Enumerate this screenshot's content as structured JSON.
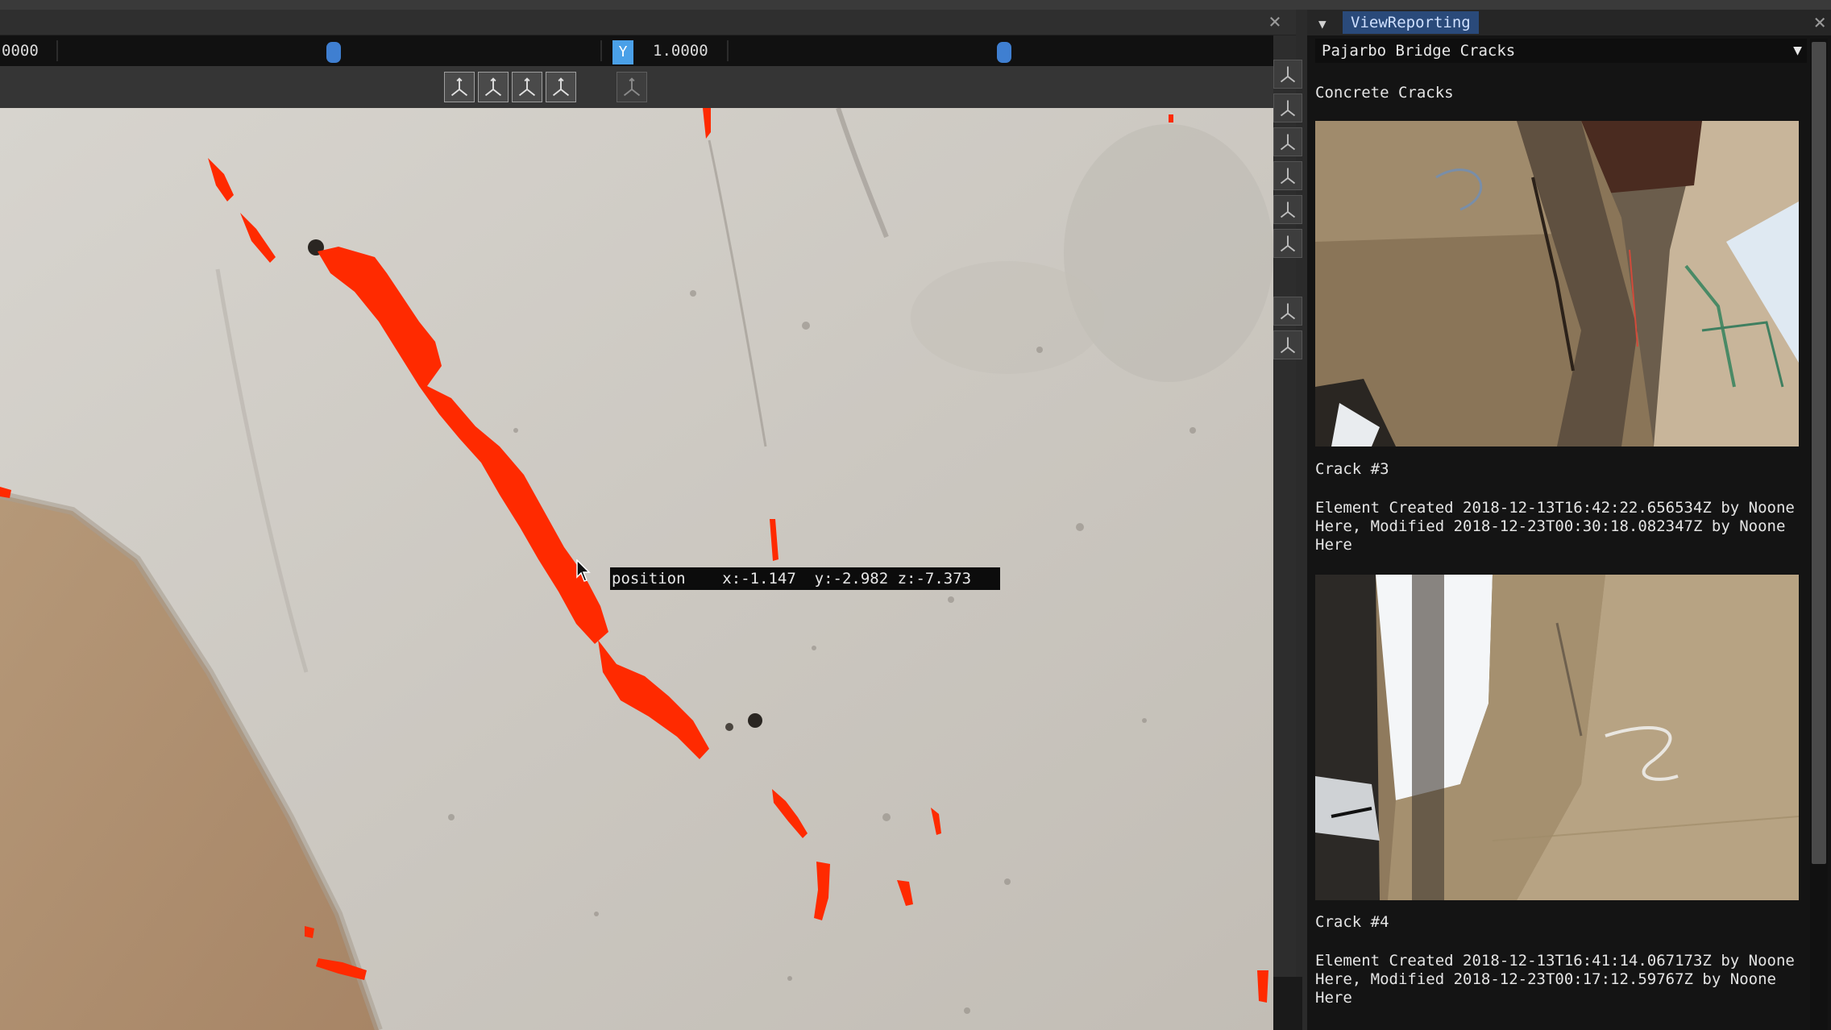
{
  "viewport": {
    "x_value": "0000",
    "y_axis_label": "Y",
    "y_value": "1.0000",
    "tooltip": "position    x:-1.147  y:-2.982 z:-7.373"
  },
  "report_panel": {
    "tab_title": "ViewReporting",
    "dataset": "Pajarbo Bridge Cracks",
    "category": "Concrete Cracks",
    "items": [
      {
        "title": "Crack #3",
        "description": "Element Created 2018-12-13T16:42:22.656534Z by Noone Here, Modified 2018-12-23T00:30:18.082347Z by Noone Here"
      },
      {
        "title": "Crack #4",
        "description": "Element Created 2018-12-13T16:41:14.067173Z by Noone Here, Modified 2018-12-23T00:17:12.59767Z by Noone Here"
      }
    ]
  },
  "colors": {
    "crack_highlight": "#ff2a00",
    "concrete": "#cfcbc4",
    "accent": "#3f7fd1"
  }
}
